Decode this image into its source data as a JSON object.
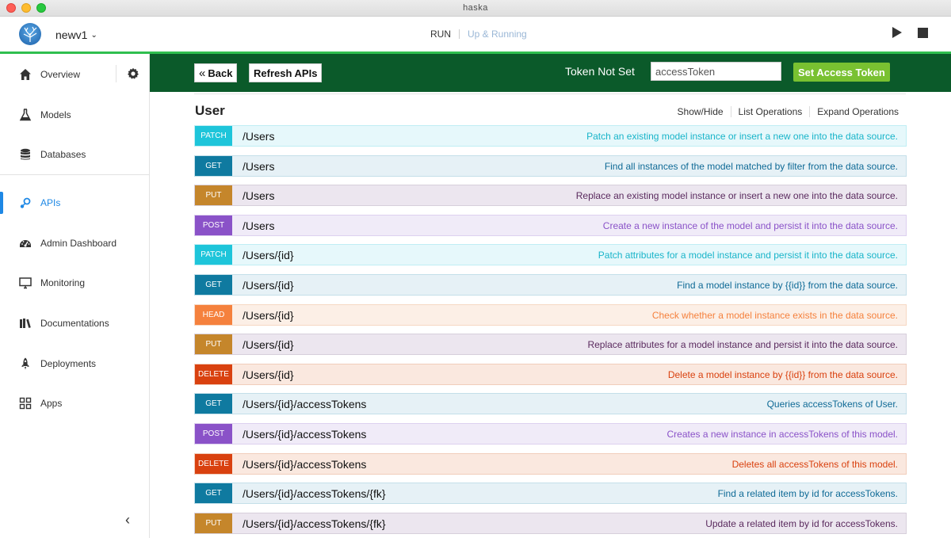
{
  "window": {
    "title": "haska"
  },
  "header": {
    "project": "newv1",
    "run_label": "RUN",
    "run_status": "Up & Running"
  },
  "sidebar": {
    "items": [
      {
        "label": "Overview",
        "icon": "home-icon"
      },
      {
        "label": "Models",
        "icon": "flask-icon"
      },
      {
        "label": "Databases",
        "icon": "database-icon"
      },
      {
        "label": "APIs",
        "icon": "api-icon",
        "active": true
      },
      {
        "label": "Admin Dashboard",
        "icon": "dashboard-icon"
      },
      {
        "label": "Monitoring",
        "icon": "monitor-icon"
      },
      {
        "label": "Documentations",
        "icon": "books-icon"
      },
      {
        "label": "Deployments",
        "icon": "rocket-icon"
      },
      {
        "label": "Apps",
        "icon": "apps-grid-icon"
      }
    ],
    "collapse_glyph": "‹"
  },
  "toolbar": {
    "back_label": "Back",
    "refresh_label": "Refresh APIs",
    "token_status": "Token Not Set",
    "token_input_value": "accessToken",
    "set_token_label": "Set Access Token"
  },
  "section": {
    "title": "User",
    "links": [
      "Show/Hide",
      "List Operations",
      "Expand Operations"
    ]
  },
  "operations": [
    {
      "method": "PATCH",
      "path": "/Users",
      "description": "Patch an existing model instance or insert a new one into the data source."
    },
    {
      "method": "GET",
      "path": "/Users",
      "description": "Find all instances of the model matched by filter from the data source."
    },
    {
      "method": "PUT",
      "path": "/Users",
      "description": "Replace an existing model instance or insert a new one into the data source."
    },
    {
      "method": "POST",
      "path": "/Users",
      "description": "Create a new instance of the model and persist it into the data source."
    },
    {
      "method": "PATCH",
      "path": "/Users/{id}",
      "description": "Patch attributes for a model instance and persist it into the data source."
    },
    {
      "method": "GET",
      "path": "/Users/{id}",
      "description": "Find a model instance by {{id}} from the data source."
    },
    {
      "method": "HEAD",
      "path": "/Users/{id}",
      "description": "Check whether a model instance exists in the data source."
    },
    {
      "method": "PUT",
      "path": "/Users/{id}",
      "description": "Replace attributes for a model instance and persist it into the data source."
    },
    {
      "method": "DELETE",
      "path": "/Users/{id}",
      "description": "Delete a model instance by {{id}} from the data source."
    },
    {
      "method": "GET",
      "path": "/Users/{id}/accessTokens",
      "description": "Queries accessTokens of User."
    },
    {
      "method": "POST",
      "path": "/Users/{id}/accessTokens",
      "description": "Creates a new instance in accessTokens of this model."
    },
    {
      "method": "DELETE",
      "path": "/Users/{id}/accessTokens",
      "description": "Deletes all accessTokens of this model."
    },
    {
      "method": "GET",
      "path": "/Users/{id}/accessTokens/{fk}",
      "description": "Find a related item by id for accessTokens."
    },
    {
      "method": "PUT",
      "path": "/Users/{id}/accessTokens/{fk}",
      "description": "Update a related item by id for accessTokens."
    }
  ],
  "colors": {
    "toolbar_bg": "#0b5a2a",
    "accent_blue": "#1e88e5",
    "header_rule": "#2fbf4f",
    "set_token_bg": "#79c131"
  }
}
